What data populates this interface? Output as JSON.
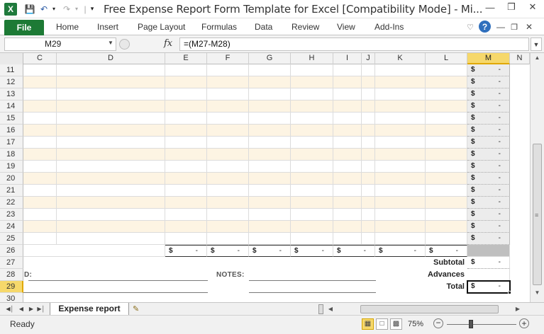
{
  "window": {
    "title": "Free Expense Report Form Template for Excel  [Compatibility Mode]  -  Mi...",
    "app_logo": "X"
  },
  "ribbon": {
    "file_label": "File",
    "tabs": [
      "Home",
      "Insert",
      "Page Layout",
      "Formulas",
      "Data",
      "Review",
      "View",
      "Add-Ins"
    ]
  },
  "formula_bar": {
    "name_box": "M29",
    "fx": "fx",
    "formula": "=(M27-M28)"
  },
  "grid": {
    "columns": [
      "C",
      "D",
      "E",
      "F",
      "G",
      "H",
      "I",
      "J",
      "K",
      "L",
      "M",
      "N"
    ],
    "selected_column": "M",
    "rows": [
      "11",
      "12",
      "13",
      "14",
      "15",
      "16",
      "17",
      "18",
      "19",
      "20",
      "21",
      "22",
      "23",
      "24",
      "25",
      "26",
      "27",
      "28",
      "29",
      "30"
    ],
    "selected_row": "29",
    "currency_symbol": "$",
    "dash": "-",
    "labels": {
      "subtotal": "Subtotal",
      "advances": "Advances",
      "total": "Total",
      "notes": "NOTES:",
      "partial_left": "D:"
    }
  },
  "sheets": {
    "active": "Expense report"
  },
  "status": {
    "text": "Ready",
    "zoom": "75%"
  }
}
